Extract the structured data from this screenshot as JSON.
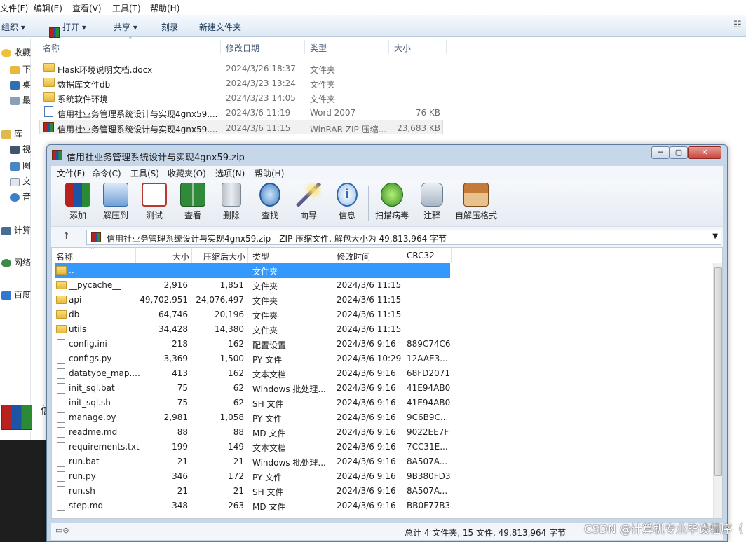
{
  "explorer": {
    "menu": [
      "文件(F)",
      "编辑(E)",
      "查看(V)",
      "工具(T)",
      "帮助(H)"
    ],
    "toolbar": {
      "organize": "组织 ▾",
      "open": "打开 ▾",
      "share": "共享 ▾",
      "burn": "刻录",
      "new_folder": "新建文件夹"
    },
    "nav": [
      "收藏",
      "下",
      "桌",
      "最",
      "库",
      "视",
      "图",
      "文",
      "音",
      "计算",
      "网络",
      "百度"
    ],
    "columns": [
      "名称",
      "修改日期",
      "类型",
      "大小"
    ],
    "rows": [
      {
        "name": "Flask环境说明文档.docx",
        "date": "2024/3/26 18:37",
        "type": "文件夹",
        "size": "",
        "icon": "folder"
      },
      {
        "name": "数据库文件db",
        "date": "2024/3/23 13:24",
        "type": "文件夹",
        "size": "",
        "icon": "folder"
      },
      {
        "name": "系统软件环境",
        "date": "2024/3/23 14:05",
        "type": "文件夹",
        "size": "",
        "icon": "folder"
      },
      {
        "name": "信用社业务管理系统设计与实现4gnx59....",
        "date": "2024/3/6 11:19",
        "type": "Word 2007",
        "size": "76 KB",
        "icon": "word-doc"
      },
      {
        "name": "信用社业务管理系统设计与实现4gnx59....",
        "date": "2024/3/6 11:15",
        "type": "WinRAR ZIP 压缩...",
        "size": "23,683 KB",
        "icon": "zip"
      }
    ],
    "taskbar_label": "信"
  },
  "winrar": {
    "title": "信用社业务管理系统设计与实现4gnx59.zip",
    "window_buttons": [
      "─",
      "▢",
      "✕"
    ],
    "menu": [
      "文件(F)",
      "命令(C)",
      "工具(S)",
      "收藏夹(O)",
      "选项(N)",
      "帮助(H)"
    ],
    "tools": [
      "添加",
      "解压到",
      "测试",
      "查看",
      "删除",
      "查找",
      "向导",
      "信息",
      "扫描病毒",
      "注释",
      "自解压格式"
    ],
    "address": "信用社业务管理系统设计与实现4gnx59.zip - ZIP 压缩文件, 解包大小为 49,813,964 字节",
    "columns": [
      "名称",
      "大小",
      "压缩后大小",
      "类型",
      "修改时间",
      "CRC32"
    ],
    "files": [
      {
        "name": "..",
        "size": "",
        "packed": "",
        "type": "文件夹",
        "modified": "",
        "crc": "",
        "icon": "folder"
      },
      {
        "name": "__pycache__",
        "size": "2,916",
        "packed": "1,851",
        "type": "文件夹",
        "modified": "2024/3/6 11:15",
        "crc": "",
        "icon": "folder"
      },
      {
        "name": "api",
        "size": "49,702,951",
        "packed": "24,076,497",
        "type": "文件夹",
        "modified": "2024/3/6 11:15",
        "crc": "",
        "icon": "folder"
      },
      {
        "name": "db",
        "size": "64,746",
        "packed": "20,196",
        "type": "文件夹",
        "modified": "2024/3/6 11:15",
        "crc": "",
        "icon": "folder"
      },
      {
        "name": "utils",
        "size": "34,428",
        "packed": "14,380",
        "type": "文件夹",
        "modified": "2024/3/6 11:15",
        "crc": "",
        "icon": "folder"
      },
      {
        "name": "config.ini",
        "size": "218",
        "packed": "162",
        "type": "配置设置",
        "modified": "2024/3/6 9:16",
        "crc": "889C74C6",
        "icon": "file"
      },
      {
        "name": "configs.py",
        "size": "3,369",
        "packed": "1,500",
        "type": "PY 文件",
        "modified": "2024/3/6 10:29",
        "crc": "12AAE3...",
        "icon": "file"
      },
      {
        "name": "datatype_map....",
        "size": "413",
        "packed": "162",
        "type": "文本文档",
        "modified": "2024/3/6 9:16",
        "crc": "68FD2071",
        "icon": "file"
      },
      {
        "name": "init_sql.bat",
        "size": "75",
        "packed": "62",
        "type": "Windows 批处理...",
        "modified": "2024/3/6 9:16",
        "crc": "41E94AB0",
        "icon": "file"
      },
      {
        "name": "init_sql.sh",
        "size": "75",
        "packed": "62",
        "type": "SH 文件",
        "modified": "2024/3/6 9:16",
        "crc": "41E94AB0",
        "icon": "file"
      },
      {
        "name": "manage.py",
        "size": "2,981",
        "packed": "1,058",
        "type": "PY 文件",
        "modified": "2024/3/6 9:16",
        "crc": "9C6B9C...",
        "icon": "file"
      },
      {
        "name": "readme.md",
        "size": "88",
        "packed": "88",
        "type": "MD 文件",
        "modified": "2024/3/6 9:16",
        "crc": "9022EE7F",
        "icon": "file"
      },
      {
        "name": "requirements.txt",
        "size": "199",
        "packed": "149",
        "type": "文本文档",
        "modified": "2024/3/6 9:16",
        "crc": "7CC31E...",
        "icon": "file"
      },
      {
        "name": "run.bat",
        "size": "21",
        "packed": "21",
        "type": "Windows 批处理...",
        "modified": "2024/3/6 9:16",
        "crc": "8A507A...",
        "icon": "file"
      },
      {
        "name": "run.py",
        "size": "346",
        "packed": "172",
        "type": "PY 文件",
        "modified": "2024/3/6 9:16",
        "crc": "9B380FD3",
        "icon": "file"
      },
      {
        "name": "run.sh",
        "size": "21",
        "packed": "21",
        "type": "SH 文件",
        "modified": "2024/3/6 9:16",
        "crc": "8A507A...",
        "icon": "file"
      },
      {
        "name": "step.md",
        "size": "348",
        "packed": "263",
        "type": "MD 文件",
        "modified": "2024/3/6 9:16",
        "crc": "BB0F77B3",
        "icon": "file"
      }
    ],
    "status": "总计 4 文件夹, 15 文件, 49,813,964 字节"
  },
  "watermark": "CSDN @计算机专业毕设程序（",
  "colors": {
    "selection": "#3399ff",
    "titlebar": "#c7d7ea",
    "close_button": "#c9463d"
  }
}
